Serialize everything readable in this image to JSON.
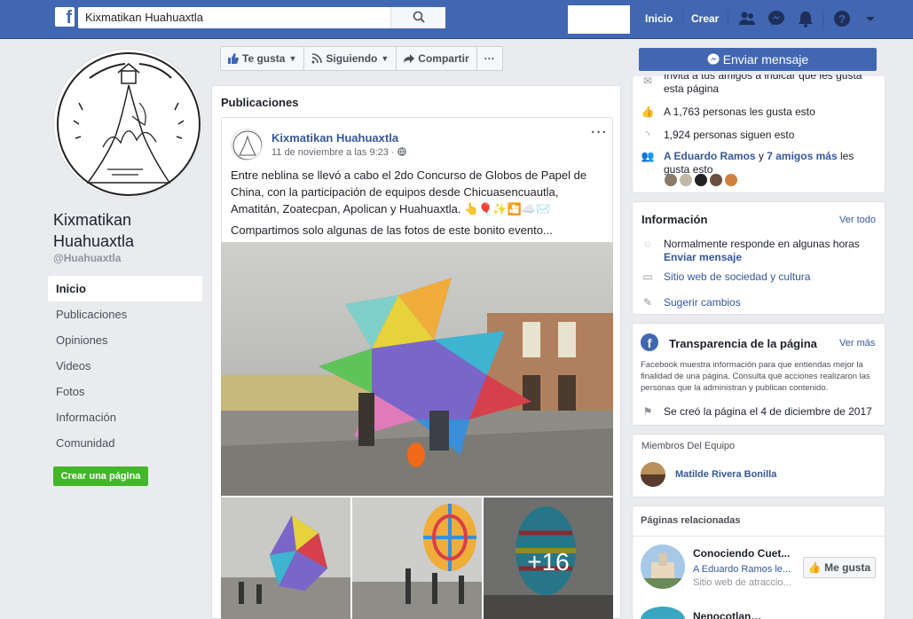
{
  "topbar": {
    "search_value": "Kixmatikan Huahuaxtla",
    "home_label": "Inicio",
    "create_label": "Crear"
  },
  "page": {
    "name_line1": "Kixmatikan",
    "name_line2": "Huahuaxtla",
    "handle": "@Huahuaxtla"
  },
  "sidebar": {
    "items": [
      {
        "label": "Inicio"
      },
      {
        "label": "Publicaciones"
      },
      {
        "label": "Opiniones"
      },
      {
        "label": "Videos"
      },
      {
        "label": "Fotos"
      },
      {
        "label": "Información"
      },
      {
        "label": "Comunidad"
      }
    ],
    "create_page_label": "Crear una página"
  },
  "actions": {
    "like_label": "Te gusta",
    "follow_label": "Siguiendo",
    "share_label": "Compartir",
    "more_label": "···"
  },
  "posts": {
    "section_title": "Publicaciones",
    "author": "Kixmatikan Huahuaxtla",
    "time": "11 de noviembre a las 9:23 ·",
    "text": "Entre neblina se llevó a cabo el 2do Concurso de Globos de Papel de China, con la participación de equipos desde Chicuasencuautla, Amatitán, Zoatecpan, Apolican y Huahuaxtla. 👆🎈✨🎦☁️✉️",
    "text2": "Compartimos solo algunas de las fotos de este bonito evento...",
    "more_photos": "+16"
  },
  "right": {
    "send_message": "Enviar mensaje",
    "invite_text": "Invita a tus amigos a indicar que les gusta esta página",
    "likes_text": "A 1,763 personas les gusta esto",
    "followers_text": "1,924 personas siguen esto",
    "friends_link": "A Eduardo Ramos",
    "friends_middle": " y ",
    "friends_count_link": "7 amigos más",
    "friends_suffix": " les gusta esto",
    "info_title": "Información",
    "info_seeall": "Ver todo",
    "response_text": "Normalmente responde en algunas horas",
    "response_link": "Enviar mensaje",
    "category_link": "Sitio web de sociedad y cultura",
    "suggest_link": "Sugerir cambios",
    "transparency_title": "Transparencia de la página",
    "transparency_more": "Ver más",
    "transparency_text": "Facebook muestra información para que entiendas mejor la finalidad de una página. Consulta qué acciones realizaron las personas que la administran y publican contenido.",
    "created_text": "Se creó la página el 4 de diciembre de 2017",
    "team_title": "Miembros Del Equipo",
    "team_member": "Matilde Rivera Bonilla",
    "related_title": "Páginas relacionadas",
    "related_name": "Conociendo Cuet...",
    "related_friend": "A Eduardo Ramos le...",
    "related_category": "Sitio web de atraccio...",
    "related_like_label": "Me gusta",
    "related2_name": "Nenocotlan…"
  },
  "colors": {
    "brand": "#4267b2",
    "link": "#365899",
    "green": "#42b72a"
  }
}
